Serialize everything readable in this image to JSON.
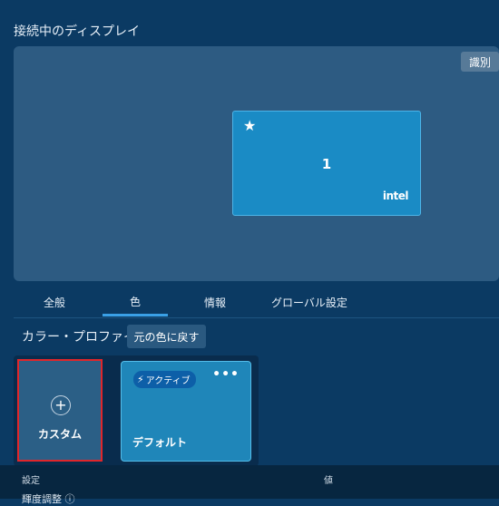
{
  "header": {
    "title": "接続中のディスプレイ"
  },
  "display_area": {
    "identify_label": "識別",
    "monitor": {
      "star_icon": "★",
      "number": "1",
      "brand": "intel"
    }
  },
  "tabs": [
    {
      "label": "全般",
      "active": false
    },
    {
      "label": "色",
      "active": true
    },
    {
      "label": "情報",
      "active": false
    },
    {
      "label": "グローバル設定",
      "active": false
    }
  ],
  "color_profile": {
    "label": "カラー・プロファイル",
    "reset_label": "元の色に戻す",
    "custom_card": {
      "plus_icon": "+",
      "label": "カスタム"
    },
    "default_card": {
      "badge_icon": "lightning-icon",
      "badge_label": "アクティブ",
      "more_icon": "•••",
      "label": "デフォルト"
    }
  },
  "settings_table": {
    "col_setting": "設定",
    "col_value": "値",
    "partial_row": "輝度調整 ⓘ"
  },
  "colors": {
    "background": "#0b3a63",
    "display_area": "#2d5b82",
    "monitor": "#1a8bc5",
    "accent": "#3aa0e6",
    "highlight_border": "#e0262b"
  }
}
